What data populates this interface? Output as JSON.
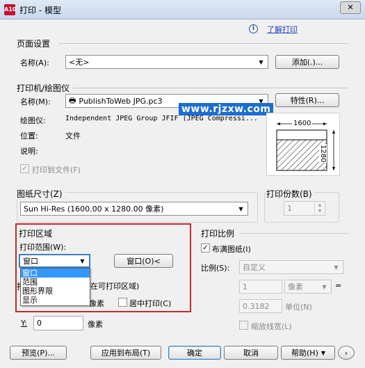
{
  "window": {
    "title": "打印 - 模型",
    "close_glyph": "✕",
    "app_icon_text": "A10"
  },
  "help_link": "了解打印",
  "page_setup": {
    "section": "页面设置",
    "name_label": "名称(A):",
    "name_value": "<无>",
    "add_button": "添加(.)..."
  },
  "printer": {
    "section": "打印机/绘图仪",
    "name_label": "名称(M):",
    "name_value": "PublishToWeb JPG.pc3",
    "properties_button": "特性(R)...",
    "plotter_label": "绘图仪:",
    "plotter_value": "Independent JPEG Group JFIF (JPEG Compressi...",
    "location_label": "位置:",
    "location_value": "文件",
    "description_label": "说明:",
    "print_to_file": "打印到文件(F)",
    "preview_width": "1600",
    "preview_height": "1280"
  },
  "watermark": "www.rjzxw.com",
  "paper_size": {
    "section": "图纸尺寸(Z)",
    "value": "Sun Hi-Res (1600.00 x 1280.00 像素)"
  },
  "copies": {
    "section": "打印份数(B)",
    "value": "1"
  },
  "print_area": {
    "section": "打印区域",
    "range_label": "打印范围(W):",
    "range_value": "窗口",
    "window_button": "窗口(O)<",
    "dropdown_options": [
      "窗口",
      "范围",
      "图形界限",
      "显示"
    ],
    "dropdown_selected_index": 0
  },
  "offset": {
    "section_partial": "打",
    "origin_partial": "在可打印区域)",
    "x_partial": "X",
    "x_unit": "像素",
    "center_label": "居中打印(C)",
    "y_label": "Y:",
    "y_value": "0",
    "y_unit": "像素"
  },
  "scale": {
    "section": "打印比例",
    "fit_label": "布满图纸(I)",
    "scale_label": "比例(S):",
    "scale_value": "自定义",
    "value1": "1",
    "unit_value": "像素",
    "equals": "=",
    "value2": "0.3182",
    "unit_label": "单位(N)",
    "lineweight_label": "缩放线宽(L)"
  },
  "buttons": {
    "preview": "预览(P)...",
    "apply_layout": "应用到布局(T)",
    "ok": "确定",
    "cancel": "取消",
    "help": "帮助(H)",
    "expand": "›"
  }
}
